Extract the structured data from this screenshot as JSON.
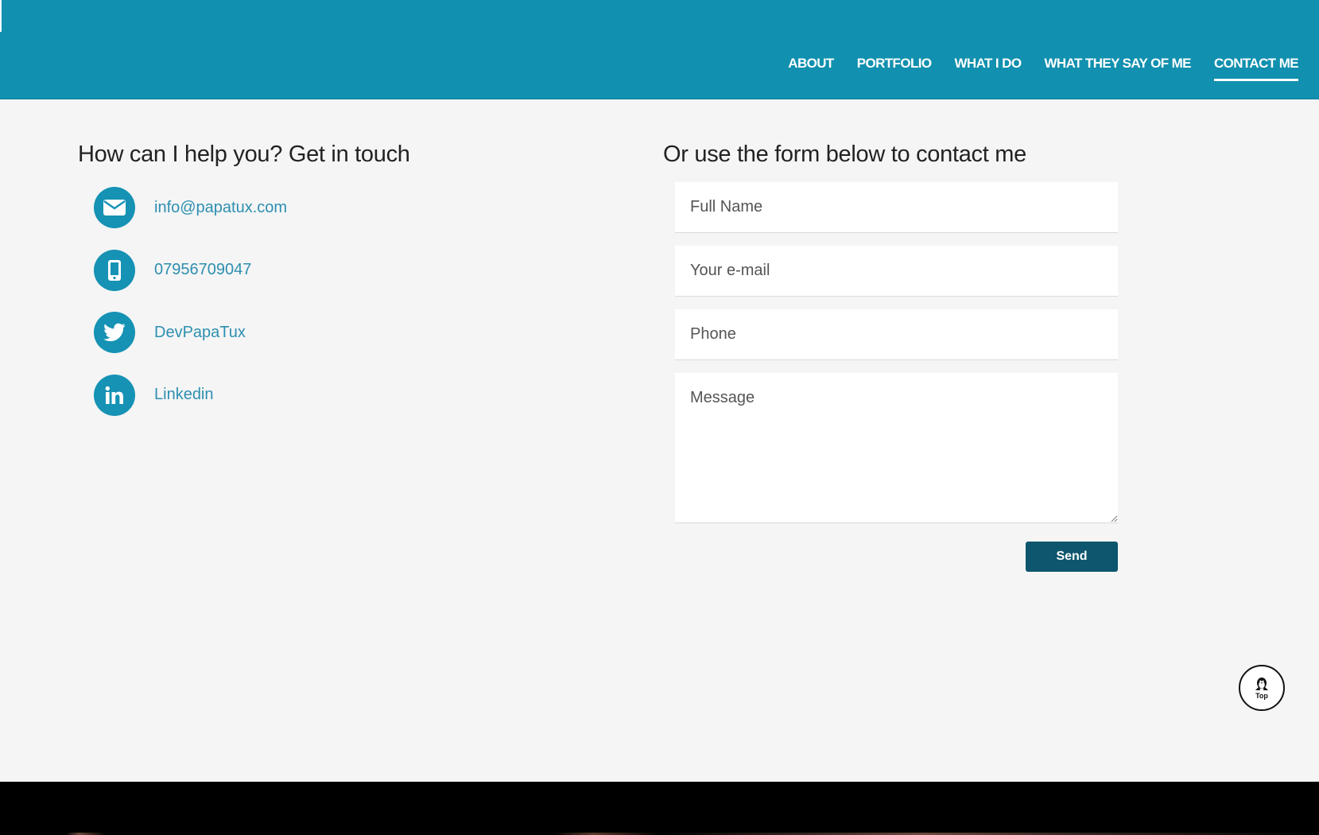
{
  "nav": {
    "items": [
      {
        "label": "ABOUT",
        "active": false
      },
      {
        "label": "PORTFOLIO",
        "active": false
      },
      {
        "label": "WHAT I DO",
        "active": false
      },
      {
        "label": "WHAT THEY SAY OF ME",
        "active": false
      },
      {
        "label": "CONTACT ME",
        "active": true
      }
    ]
  },
  "contact": {
    "title": "How can I help you? Get in touch",
    "items": [
      {
        "icon": "envelope-icon",
        "label": "info@papatux.com"
      },
      {
        "icon": "mobile-phone-icon",
        "label": "07956709047"
      },
      {
        "icon": "twitter-icon",
        "label": "DevPapaTux"
      },
      {
        "icon": "linkedin-icon",
        "label": "Linkedin"
      }
    ]
  },
  "form": {
    "title": "Or use the form below to contact me",
    "full_name_placeholder": "Full Name",
    "email_placeholder": "Your e-mail",
    "phone_placeholder": "Phone",
    "message_placeholder": "Message",
    "send_label": "Send"
  },
  "top_button": {
    "icon": "penguin-icon",
    "label": "Top"
  },
  "colors": {
    "header": "#1190af",
    "icon_circle": "#1592b4",
    "link": "#2d8fb0",
    "send_button": "#0d566d",
    "background": "#f5f5f5",
    "footer": "#000000"
  }
}
